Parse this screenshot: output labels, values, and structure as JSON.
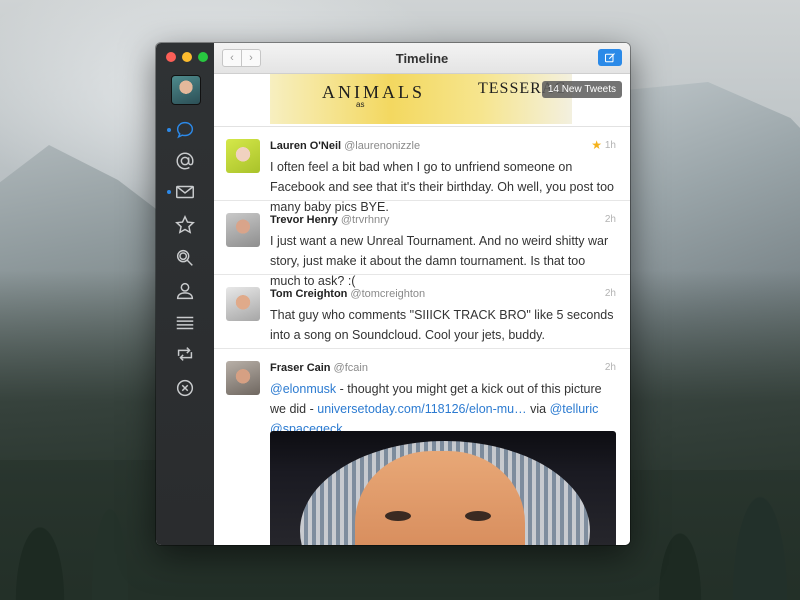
{
  "window": {
    "title": "Timeline",
    "nav_back": "‹",
    "nav_forward": "›"
  },
  "sidebar": {
    "items": [
      {
        "name": "timeline",
        "icon": "speech-bubble-icon",
        "active": true,
        "unread": true
      },
      {
        "name": "mentions",
        "icon": "at-icon",
        "active": false,
        "unread": false
      },
      {
        "name": "messages",
        "icon": "envelope-icon",
        "active": false,
        "unread": true
      },
      {
        "name": "favorites",
        "icon": "star-icon",
        "active": false,
        "unread": false
      },
      {
        "name": "search",
        "icon": "magnifier-icon",
        "active": false,
        "unread": false
      },
      {
        "name": "profile",
        "icon": "person-icon",
        "active": false,
        "unread": false
      },
      {
        "name": "lists",
        "icon": "list-icon",
        "active": false,
        "unread": false
      },
      {
        "name": "retweets",
        "icon": "retweet-icon",
        "active": false,
        "unread": false
      },
      {
        "name": "muted",
        "icon": "mute-icon",
        "active": false,
        "unread": false
      }
    ]
  },
  "banner": {
    "text_left": "ANIMALS",
    "text_sub": "as",
    "text_right": "TESSERAC",
    "new_tweets": "14 New Tweets"
  },
  "tweets": [
    {
      "name": "Lauren O'Neil",
      "handle": "@laurenonizzle",
      "time": "1h",
      "favorited": true,
      "text": "I often feel a bit bad when I go to unfriend someone on Facebook and see that it's their birthday. Oh well, you post too many baby pics BYE."
    },
    {
      "name": "Trevor Henry",
      "handle": "@trvrhnry",
      "time": "2h",
      "favorited": false,
      "text": "I just want a new Unreal Tournament. And no weird shitty war story, just make it about the damn tournament. Is that too much to ask? :("
    },
    {
      "name": "Tom Creighton",
      "handle": "@tomcreighton",
      "time": "2h",
      "favorited": false,
      "text": "That guy who comments \"SIIICK TRACK BRO\" like 5 seconds into a song on Soundcloud. Cool your jets, buddy."
    },
    {
      "name": "Fraser Cain",
      "handle": "@fcain",
      "time": "2h",
      "favorited": false,
      "text_mention": "@elonmusk",
      "text_mid": " - thought you might get a kick out of this picture we did - ",
      "text_link": "universetoday.com/118126/elon-mu…",
      "text_via": " via ",
      "text_mention2": "@telluric",
      "text_mention3": "@spacegeck"
    }
  ],
  "colors": {
    "accent": "#2c89e8",
    "sidebar": "#2f3234",
    "star": "#f5b21b"
  }
}
